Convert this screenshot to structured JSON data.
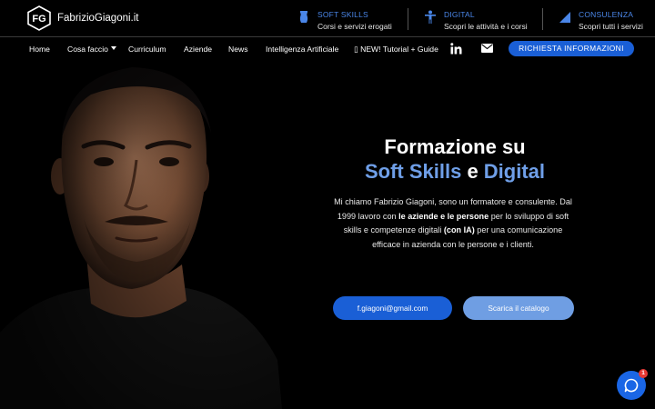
{
  "brand": {
    "logo_text": "FG",
    "name": "FabrizioGiagoni.it"
  },
  "features": [
    {
      "icon": "vase-icon",
      "title": "SOFT SKILLS",
      "subtitle": "Corsi e servizi erogati"
    },
    {
      "icon": "person-figure-icon",
      "title": "DIGITAL",
      "subtitle": "Scopri le attività e i corsi"
    },
    {
      "icon": "triangle-icon",
      "title": "CONSULENZA",
      "subtitle": "Scopri tutti i servizi"
    }
  ],
  "nav": {
    "home": "Home",
    "cosa_faccio": "Cosa faccio",
    "curriculum": "Curriculum",
    "aziende": "Aziende",
    "news": "News",
    "ia": "Intelligenza Artificiale",
    "tutorial": "▯ NEW! Tutorial + Guide",
    "linkedin_icon": "linkedin-icon",
    "mail_icon": "mail-icon",
    "cta": "RICHIESTA INFORMAZIONI"
  },
  "hero": {
    "title_line1": "Formazione su",
    "title_blue1": "Soft Skills",
    "title_and": " e ",
    "title_blue2": "Digital",
    "text_a": "Mi chiamo Fabrizio Giagoni, sono un formatore e consulente. Dal 1999 lavoro con ",
    "text_b": "le aziende e le persone",
    "text_c": " per lo sviluppo di soft skills e competenze digitali ",
    "text_d": "(con IA)",
    "text_e": " per una comunicazione efficace in azienda con le persone e i clienti.",
    "email_button": "f.giagoni@gmail.com",
    "catalog_button": "Scarica il catalogo"
  },
  "chat": {
    "icon": "chat-bubble-icon",
    "badge": "1"
  },
  "colors": {
    "accent": "#1a5fd6",
    "accent_light": "#6f9fe8",
    "background": "#000000"
  }
}
